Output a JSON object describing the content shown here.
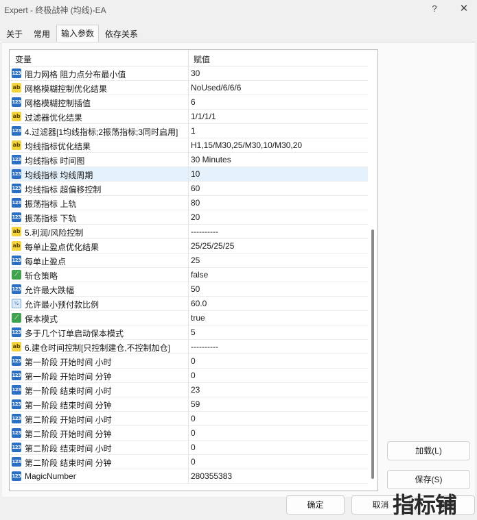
{
  "window": {
    "title": "Expert - 终极战神 (均线)-EA",
    "help_label": "?",
    "close_label": "✕"
  },
  "tabs": [
    {
      "label": "关于",
      "active": false
    },
    {
      "label": "常用",
      "active": false
    },
    {
      "label": "输入参数",
      "active": true
    },
    {
      "label": "依存关系",
      "active": false
    }
  ],
  "grid": {
    "header_variable": "变量",
    "header_value": "赋值",
    "rows": [
      {
        "icon": "int",
        "name": "阻力网格 阻力点分布最小值",
        "value": "30"
      },
      {
        "icon": "str",
        "name": "网格模糊控制优化结果",
        "value": "NoUsed/6/6/6"
      },
      {
        "icon": "int",
        "name": "网格模糊控制插值",
        "value": "6"
      },
      {
        "icon": "str",
        "name": "过滤器优化结果",
        "value": "1/1/1/1"
      },
      {
        "icon": "int",
        "name": "4.过滤器[1均线指标;2振荡指标;3同时启用]",
        "value": "1"
      },
      {
        "icon": "str",
        "name": "均线指标优化结果",
        "value": "H1,15/M30,25/M30,10/M30,20"
      },
      {
        "icon": "int",
        "name": "均线指标 时间图",
        "value": "30 Minutes"
      },
      {
        "icon": "int",
        "name": "均线指标 均线周期",
        "value": "10",
        "selected": true
      },
      {
        "icon": "int",
        "name": "均线指标 超偏移控制",
        "value": "60"
      },
      {
        "icon": "int",
        "name": "振荡指标 上轨",
        "value": "80"
      },
      {
        "icon": "int",
        "name": "振荡指标 下轨",
        "value": "20"
      },
      {
        "icon": "str",
        "name": "5.利润/风险控制",
        "value": "----------"
      },
      {
        "icon": "str",
        "name": "每单止盈点优化结果",
        "value": "25/25/25/25"
      },
      {
        "icon": "int",
        "name": "每单止盈点",
        "value": "25"
      },
      {
        "icon": "bool",
        "name": "斩仓策略",
        "value": "false"
      },
      {
        "icon": "int",
        "name": "允许最大跌幅",
        "value": "50"
      },
      {
        "icon": "dbl",
        "name": "允许最小预付款比例",
        "value": "60.0"
      },
      {
        "icon": "bool",
        "name": "保本模式",
        "value": "true"
      },
      {
        "icon": "int",
        "name": "多于几个订单启动保本模式",
        "value": "5"
      },
      {
        "icon": "str",
        "name": "6.建仓时间控制[只控制建仓,不控制加仓]",
        "value": "----------"
      },
      {
        "icon": "int",
        "name": "第一阶段 开始时间 小时",
        "value": "0"
      },
      {
        "icon": "int",
        "name": "第一阶段 开始时间 分钟",
        "value": "0"
      },
      {
        "icon": "int",
        "name": "第一阶段 结束时间 小时",
        "value": "23"
      },
      {
        "icon": "int",
        "name": "第一阶段 结束时间 分钟",
        "value": "59"
      },
      {
        "icon": "int",
        "name": "第二阶段 开始时间 小时",
        "value": "0"
      },
      {
        "icon": "int",
        "name": "第二阶段 开始时间 分钟",
        "value": "0"
      },
      {
        "icon": "int",
        "name": "第二阶段 结束时间 小时",
        "value": "0"
      },
      {
        "icon": "int",
        "name": "第二阶段 结束时间 分钟",
        "value": "0"
      },
      {
        "icon": "int",
        "name": "MagicNumber",
        "value": "280355383"
      }
    ]
  },
  "icon_glyphs": {
    "int": "123",
    "str": "ab",
    "bool": "⟋",
    "dbl": "½"
  },
  "buttons": {
    "load": "加载(L)",
    "save": "保存(S)",
    "ok": "确定",
    "cancel": "取消",
    "reset": "重置"
  },
  "watermark": "指标铺"
}
